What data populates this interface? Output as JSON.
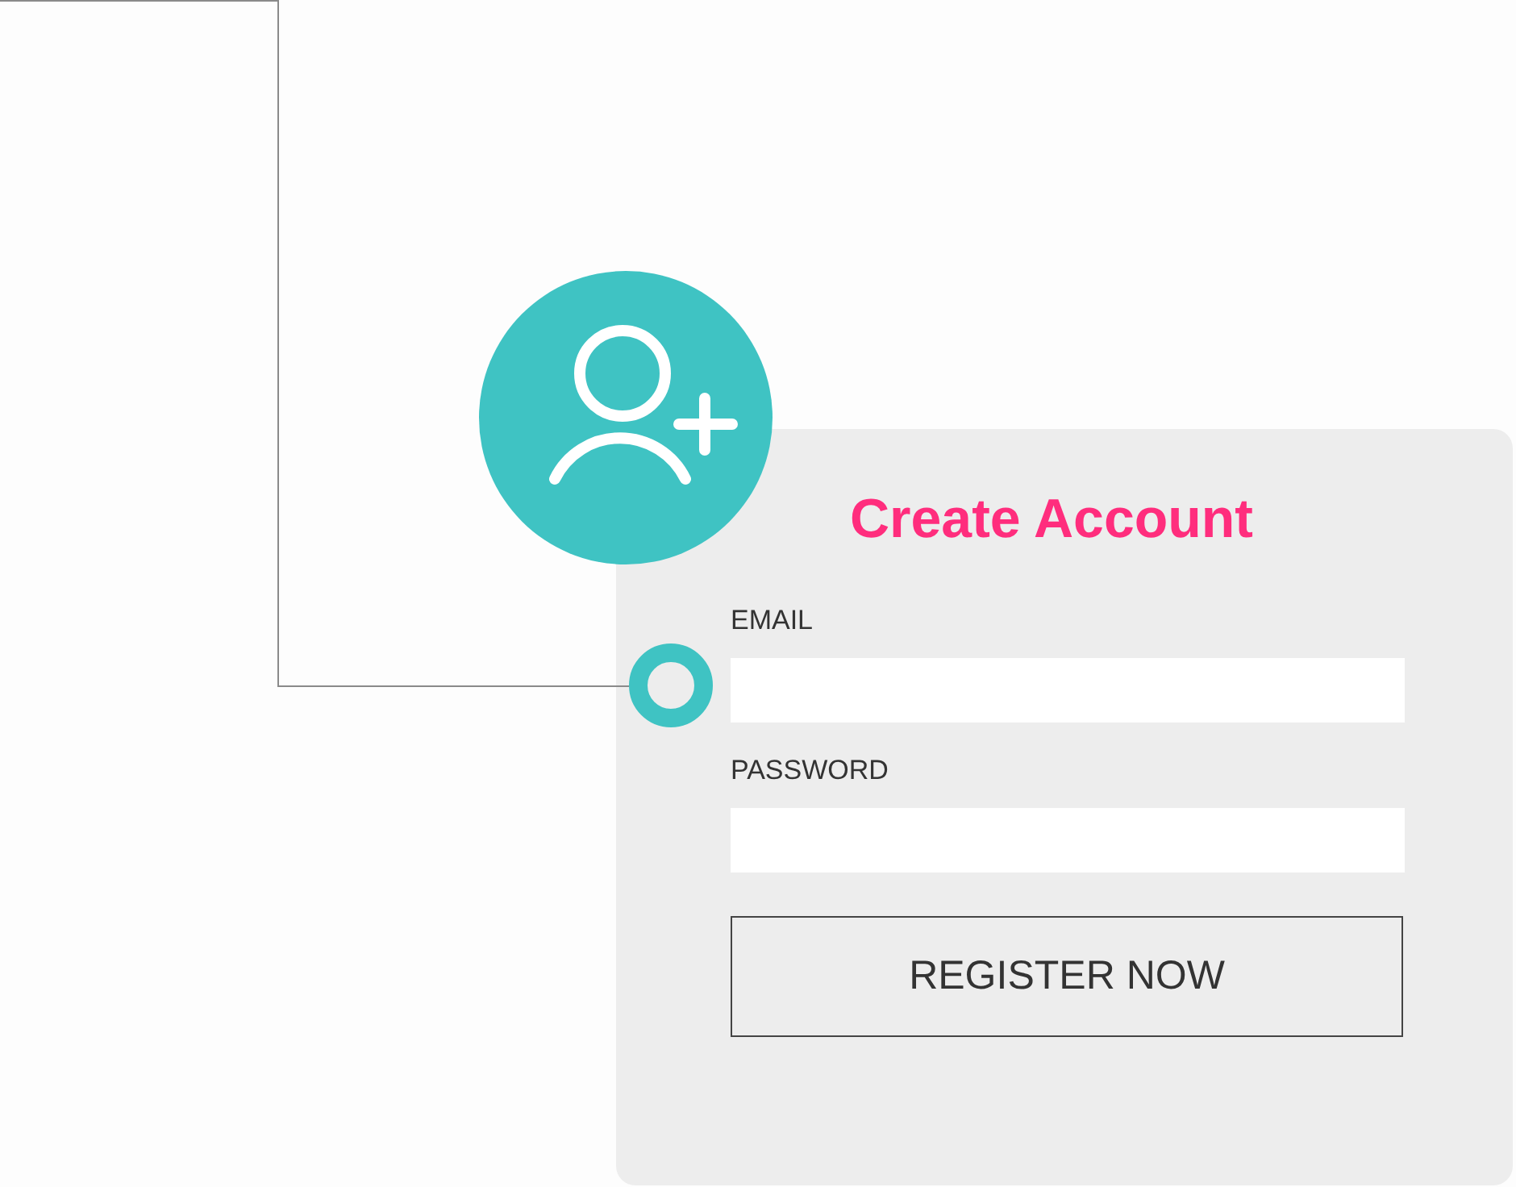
{
  "card": {
    "title": "Create Account",
    "fields": [
      {
        "label": "EMAIL"
      },
      {
        "label": "PASSWORD"
      }
    ],
    "button": "REGISTER NOW"
  }
}
